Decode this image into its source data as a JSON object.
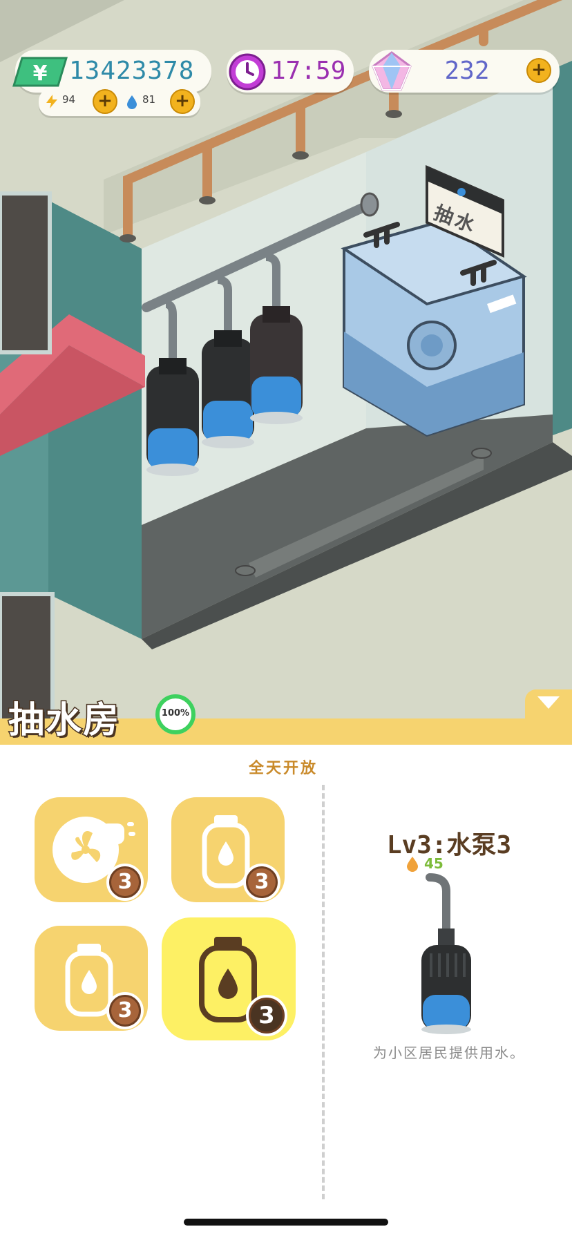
{
  "hud": {
    "money": "13423378",
    "money_icon": "yen-banknote-icon",
    "energy": "94",
    "water": "81",
    "time": "17:59",
    "gems": "232"
  },
  "scene": {
    "sign_label": "抽水",
    "pumps": [
      {
        "name": "pump-1",
        "water_level": 0.4
      },
      {
        "name": "pump-2",
        "water_level": 0.4
      },
      {
        "name": "pump-3",
        "water_level": 0.4
      }
    ]
  },
  "room": {
    "title": "抽水房",
    "progress_label": "100%",
    "progress": 1.0,
    "hours": "全天开放"
  },
  "items": [
    {
      "icon": "fan-blower-icon",
      "count": "3",
      "selected": false
    },
    {
      "icon": "water-bottle-icon",
      "count": "3",
      "selected": false
    },
    {
      "icon": "water-bottle-icon",
      "count": "3",
      "selected": false
    },
    {
      "icon": "water-bottle-icon",
      "count": "3",
      "selected": true
    }
  ],
  "detail": {
    "title": "Lv3:水泵3",
    "cost": "45",
    "description": "为小区居民提供用水。"
  },
  "colors": {
    "panel_yellow": "#f6d36f",
    "selected_yellow": "#fdf064",
    "badge_brown": "#a7643a",
    "money_text": "#2e8aa8",
    "time_text": "#9a2fb0",
    "gem_text": "#6167c9"
  }
}
